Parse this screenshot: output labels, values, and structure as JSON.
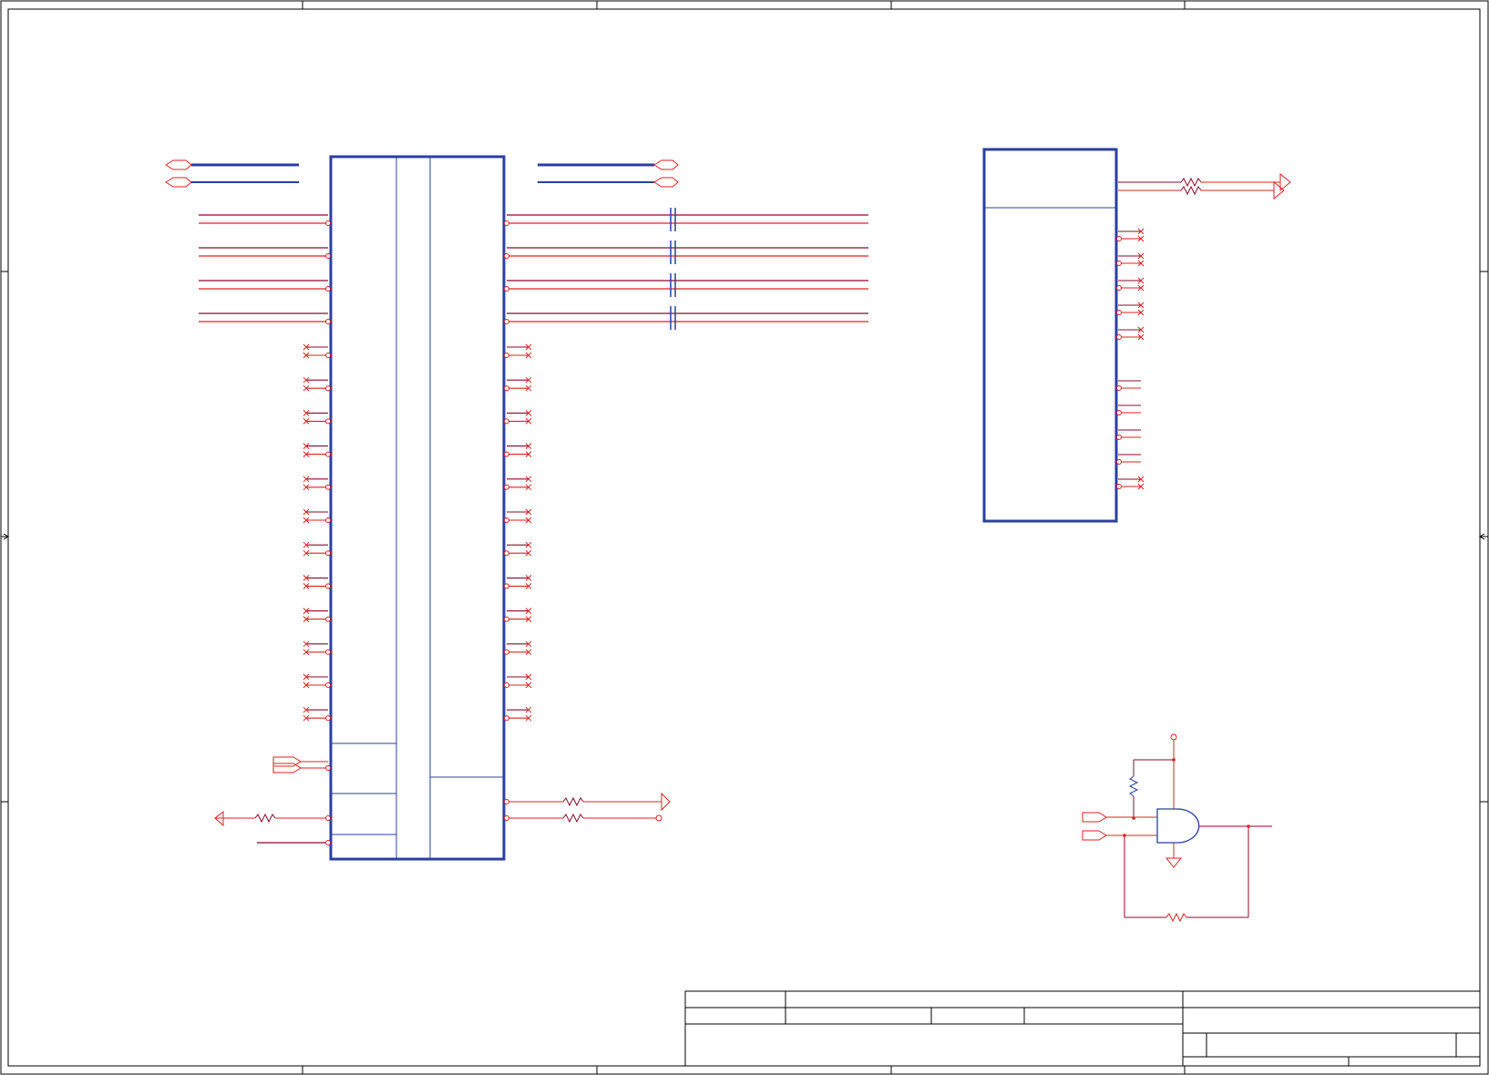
{
  "sheet": {
    "title_block_text": [],
    "colors": {
      "frame": "#000000",
      "component": "#2b3fa0",
      "net": "#e02020",
      "wire": "#8b0a2a"
    }
  },
  "components": [
    {
      "id": "main-connector-ic",
      "kind": "ic-body",
      "labels": []
    },
    {
      "id": "secondary-ic",
      "kind": "ic-body",
      "labels": []
    },
    {
      "id": "and-gate",
      "kind": "logic-and-gate",
      "labels": []
    }
  ],
  "icons": {
    "port_bidir": "hexagon-port-icon",
    "port_out": "arrow-port-icon",
    "capacitor": "capacitor-icon",
    "resistor": "resistor-icon",
    "no_connect": "no-connect-x-icon",
    "ground": "ground-icon",
    "power": "power-pin-icon"
  }
}
